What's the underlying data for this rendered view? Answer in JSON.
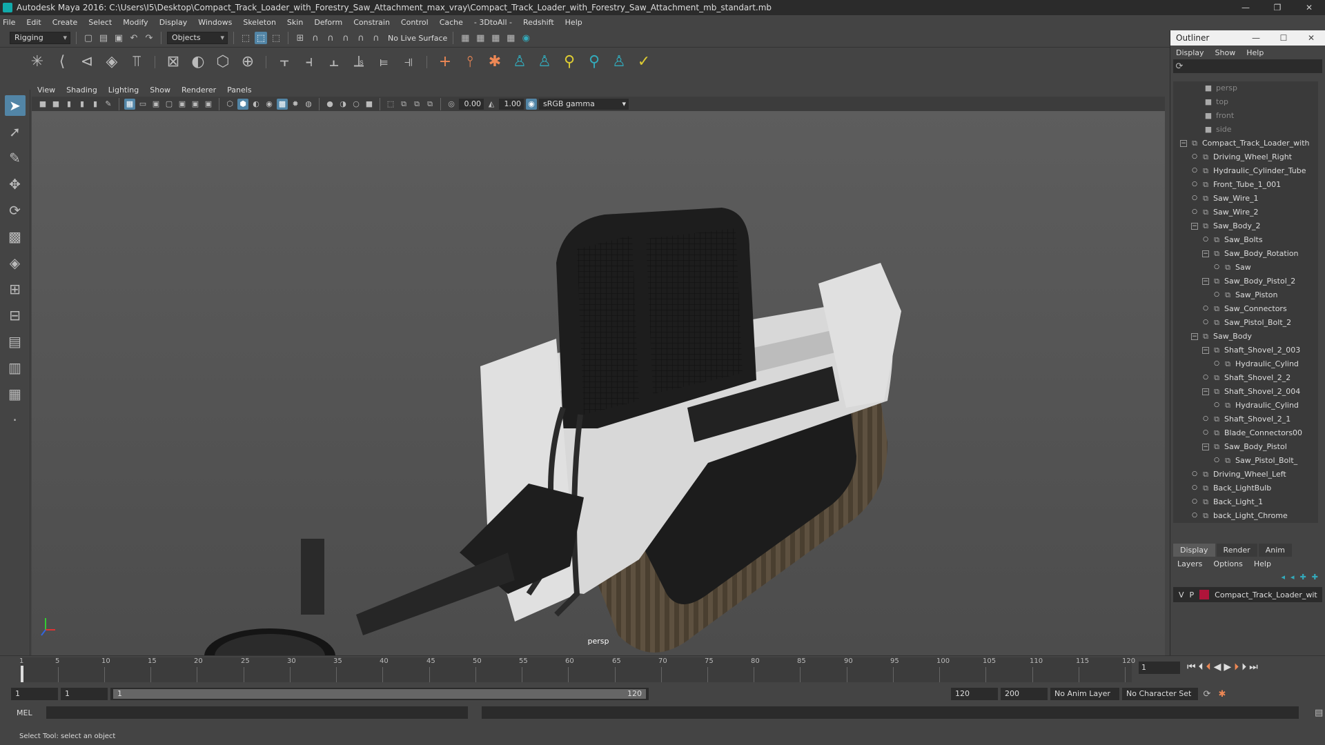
{
  "title": "Autodesk Maya 2016: C:\\Users\\I5\\Desktop\\Compact_Track_Loader_with_Forestry_Saw_Attachment_max_vray\\Compact_Track_Loader_with_Forestry_Saw_Attachment_mb_standart.mb",
  "menus": [
    "File",
    "Edit",
    "Create",
    "Select",
    "Modify",
    "Display",
    "Windows",
    "Skeleton",
    "Skin",
    "Deform",
    "Constrain",
    "Control",
    "Cache",
    "- 3DtoAll -",
    "Redshift",
    "Help"
  ],
  "shelf": {
    "mode": "Rigging",
    "objects": "Objects",
    "live_surface": "No Live Surface"
  },
  "panel": {
    "menus": [
      "View",
      "Shading",
      "Lighting",
      "Show",
      "Renderer",
      "Panels"
    ],
    "exposure": "0.00",
    "gamma": "1.00",
    "colorspace": "sRGB gamma",
    "camera_label": "persp"
  },
  "outliner": {
    "title": "Outliner",
    "menus": [
      "Display",
      "Show",
      "Help"
    ],
    "items": [
      {
        "label": "persp",
        "depth": 0,
        "dim": true,
        "exp": ""
      },
      {
        "label": "top",
        "depth": 0,
        "dim": true,
        "exp": ""
      },
      {
        "label": "front",
        "depth": 0,
        "dim": true,
        "exp": ""
      },
      {
        "label": "side",
        "depth": 0,
        "dim": true,
        "exp": ""
      },
      {
        "label": "Compact_Track_Loader_with",
        "depth": 0,
        "exp": "−"
      },
      {
        "label": "Driving_Wheel_Right",
        "depth": 1,
        "exp": ""
      },
      {
        "label": "Hydraulic_Cylinder_Tube",
        "depth": 1,
        "exp": ""
      },
      {
        "label": "Front_Tube_1_001",
        "depth": 1,
        "exp": ""
      },
      {
        "label": "Saw_Wire_1",
        "depth": 1,
        "exp": ""
      },
      {
        "label": "Saw_Wire_2",
        "depth": 1,
        "exp": ""
      },
      {
        "label": "Saw_Body_2",
        "depth": 1,
        "exp": "−"
      },
      {
        "label": "Saw_Bolts",
        "depth": 2,
        "exp": ""
      },
      {
        "label": "Saw_Body_Rotation",
        "depth": 2,
        "exp": "−"
      },
      {
        "label": "Saw",
        "depth": 3,
        "exp": ""
      },
      {
        "label": "Saw_Body_Pistol_2",
        "depth": 2,
        "exp": "−"
      },
      {
        "label": "Saw_Piston",
        "depth": 3,
        "exp": ""
      },
      {
        "label": "Saw_Connectors",
        "depth": 2,
        "exp": ""
      },
      {
        "label": "Saw_Pistol_Bolt_2",
        "depth": 2,
        "exp": ""
      },
      {
        "label": "Saw_Body",
        "depth": 1,
        "exp": "−"
      },
      {
        "label": "Shaft_Shovel_2_003",
        "depth": 2,
        "exp": "−"
      },
      {
        "label": "Hydraulic_Cylind",
        "depth": 3,
        "exp": ""
      },
      {
        "label": "Shaft_Shovel_2_2",
        "depth": 2,
        "exp": ""
      },
      {
        "label": "Shaft_Shovel_2_004",
        "depth": 2,
        "exp": "−"
      },
      {
        "label": "Hydraulic_Cylind",
        "depth": 3,
        "exp": ""
      },
      {
        "label": "Shaft_Shovel_2_1",
        "depth": 2,
        "exp": ""
      },
      {
        "label": "Blade_Connectors00",
        "depth": 2,
        "exp": ""
      },
      {
        "label": "Saw_Body_Pistol",
        "depth": 2,
        "exp": "−"
      },
      {
        "label": "Saw_Pistol_Bolt_",
        "depth": 3,
        "exp": ""
      },
      {
        "label": "Driving_Wheel_Left",
        "depth": 1,
        "exp": ""
      },
      {
        "label": "Back_LightBulb",
        "depth": 1,
        "exp": ""
      },
      {
        "label": "Back_Light_1",
        "depth": 1,
        "exp": ""
      },
      {
        "label": "back_Light_Chrome",
        "depth": 1,
        "exp": ""
      }
    ]
  },
  "layers": {
    "tabs": [
      "Display",
      "Render",
      "Anim"
    ],
    "menus": [
      "Layers",
      "Options",
      "Help"
    ],
    "row": {
      "v": "V",
      "p": "P",
      "name": "Compact_Track_Loader_wit",
      "color": "#b0143a"
    }
  },
  "timeline": {
    "ticks": [
      "1",
      "5",
      "10",
      "15",
      "20",
      "25",
      "30",
      "35",
      "40",
      "45",
      "50",
      "55",
      "60",
      "65",
      "70",
      "75",
      "80",
      "85",
      "90",
      "95",
      "100",
      "105",
      "110",
      "115",
      "120"
    ],
    "current_frame": "1"
  },
  "range": {
    "start": "1",
    "start2": "1",
    "slider_start": "1",
    "slider_end": "120",
    "end": "120",
    "end2": "200",
    "anim_layer": "No Anim Layer",
    "char_set": "No Character Set"
  },
  "command": {
    "label": "MEL"
  },
  "help": "Select Tool: select an object"
}
